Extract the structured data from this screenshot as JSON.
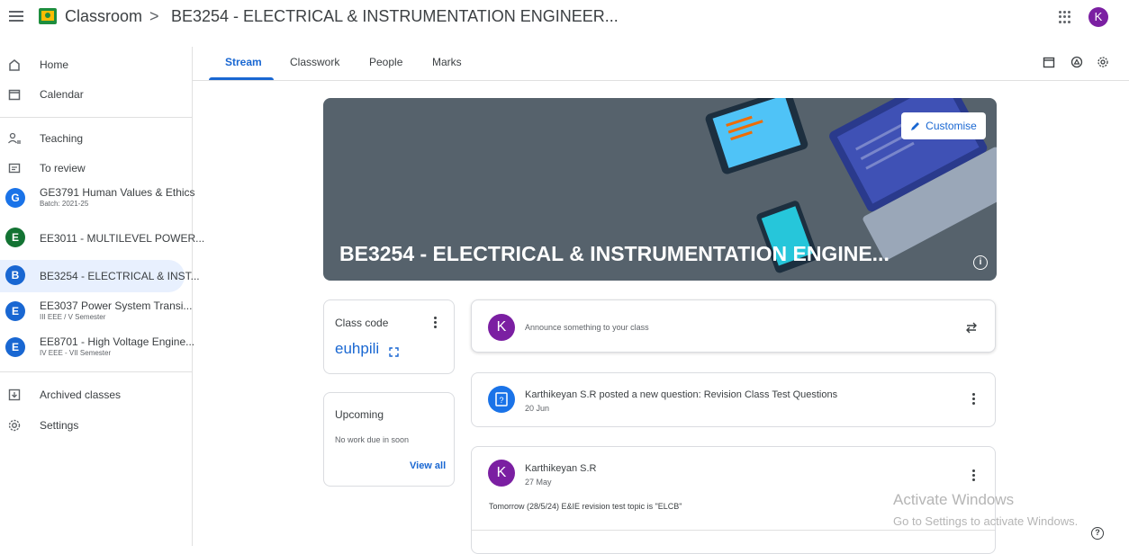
{
  "header": {
    "app_name": "Classroom",
    "separator": ">",
    "class_name": "BE3254 - ELECTRICAL & INSTRUMENTATION ENGINEER...",
    "avatar_letter": "K"
  },
  "sidebar": {
    "home": "Home",
    "calendar": "Calendar",
    "teaching": "Teaching",
    "to_review": "To review",
    "classes": [
      {
        "letter": "G",
        "title": "GE3791 Human Values & Ethics",
        "subtitle": "Batch: 2021-25",
        "color": "#1a73e8"
      },
      {
        "letter": "E",
        "title": "EE3011 - MULTILEVEL POWER...",
        "subtitle": "",
        "color": "#137333"
      },
      {
        "letter": "B",
        "title": "BE3254 - ELECTRICAL & INST...",
        "subtitle": "",
        "color": "#1967d2"
      },
      {
        "letter": "E",
        "title": "EE3037 Power System Transi...",
        "subtitle": "III EEE / V Semester",
        "color": "#1967d2"
      },
      {
        "letter": "E",
        "title": "EE8701 - High Voltage Engine...",
        "subtitle": "IV EEE - VII Semester",
        "color": "#1967d2"
      }
    ],
    "archived": "Archived classes",
    "settings": "Settings"
  },
  "tabs": [
    "Stream",
    "Classwork",
    "People",
    "Marks"
  ],
  "banner": {
    "title": "BE3254 - ELECTRICAL & INSTRUMENTATION ENGINE...",
    "customise": "Customise"
  },
  "class_code": {
    "label": "Class code",
    "value": "euhpili"
  },
  "upcoming": {
    "title": "Upcoming",
    "empty": "No work due in soon",
    "view_all": "View all"
  },
  "stream": {
    "announce_placeholder": "Announce something to your class",
    "posts": [
      {
        "title": "Karthikeyan S.R posted a new question: Revision Class Test Questions",
        "date": "20 Jun"
      },
      {
        "title": "Karthikeyan S.R",
        "date": "27 May",
        "body": "Tomorrow (28/5/24) E&IE revision test topic is \"ELCB\""
      }
    ]
  },
  "watermark": {
    "line1": "Activate Windows",
    "line2": "Go to Settings to activate Windows."
  },
  "colors": {
    "accent": "#1967d2",
    "avatar": "#7b1fa2",
    "banner": "#56626c"
  }
}
